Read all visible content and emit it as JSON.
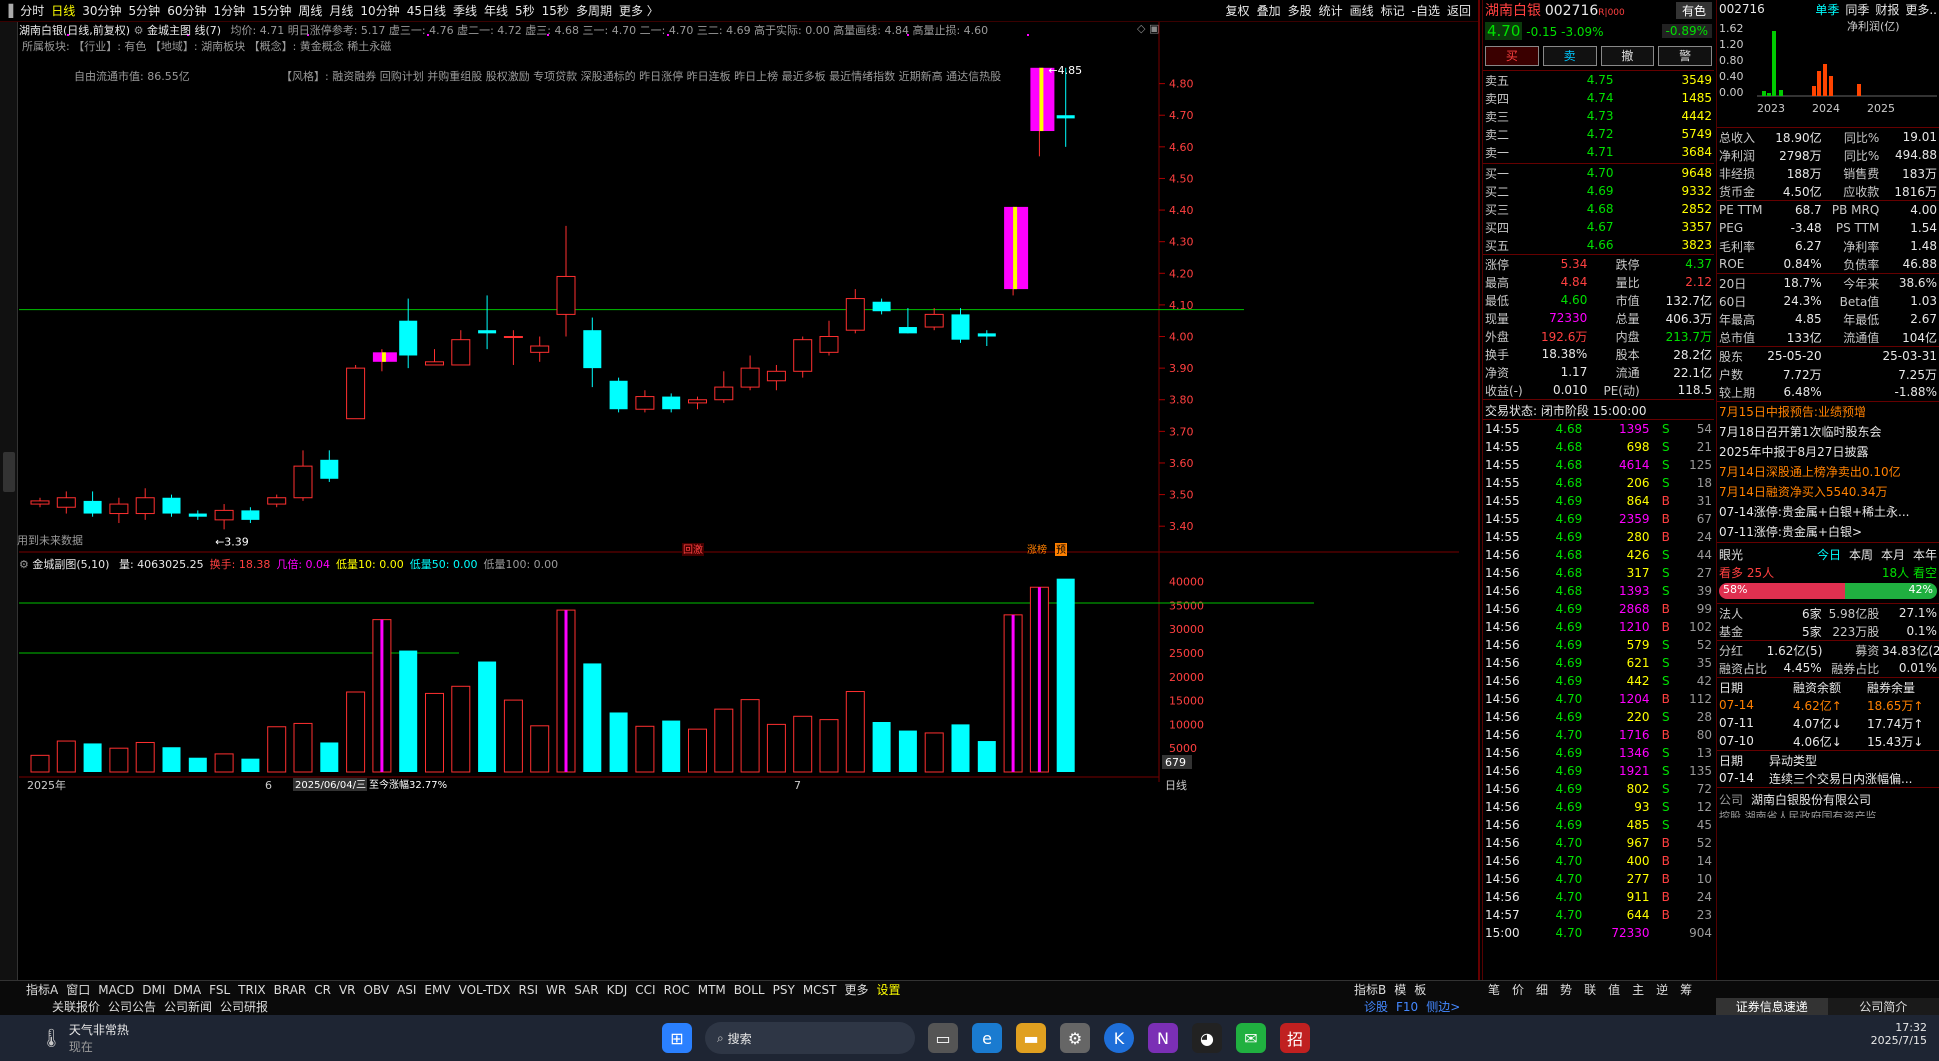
{
  "period_tabs": [
    "分时",
    "日线",
    "30分钟",
    "5分钟",
    "60分钟",
    "1分钟",
    "15分钟",
    "周线",
    "月线",
    "10分钟",
    "45日线",
    "季线",
    "年线",
    "5秒",
    "15秒",
    "多周期",
    "更多 〉"
  ],
  "top_right_menu": [
    "复权",
    "叠加",
    "多股",
    "统计",
    "画线",
    "标记",
    "-自选",
    "返回"
  ],
  "chart_title": "湖南白银(日线,前复权)",
  "indicator_main": "金城主图 线(7)",
  "stats_line": "均价: 4.71 明日涨停参考: 5.17 虚三一: 4.76 虚二一: 4.72 虚三: 4.68 三一: 4.70 二一: 4.70 三二: 4.69 高于实际: 0.00 高量画线: 4.84 高量止损: 4.60",
  "info_line": "所属板块:   【行业】: 有色   【地域】: 湖南板块   【概念】: 黄金概念 稀土永磁",
  "float_cap": "自由流通市值: 86.55亿",
  "style_line": "【风格】: 融资融券 回购计划 并购重组股 股权激励 专项贷款 深股通标的 昨日涨停 昨日连板 昨日上榜 最近多板 最近情绪指数 近期新高 通达信热股",
  "future_label": "用到未来数据",
  "low_label": "←3.39",
  "high_label": "←4.85",
  "tag_huiji": "回激",
  "tag_zhangbang": "涨榜",
  "tag_yu": "预",
  "price_ticks": [
    "4.80",
    "4.70",
    "4.60",
    "4.50",
    "4.40",
    "4.30",
    "4.20",
    "4.10",
    "4.00",
    "3.90",
    "3.80",
    "3.70",
    "3.60",
    "3.50",
    "3.40"
  ],
  "sub_title": "金城副图(5,10)",
  "sub_line": [
    {
      "t": "量: 4063025.25",
      "cls": "w"
    },
    {
      "t": "换手: 18.38",
      "cls": "r"
    },
    {
      "t": "几倍: 0.04",
      "cls": "m"
    },
    {
      "t": "低量10: 0.00",
      "cls": "y"
    },
    {
      "t": "低量50: 0.00",
      "cls": "c"
    },
    {
      "t": "低量100: 0.00",
      "cls": "gr"
    }
  ],
  "vol_ticks": [
    "40000",
    "35000",
    "30000",
    "25000",
    "20000",
    "15000",
    "10000",
    "5000"
  ],
  "vol_cursor": "679",
  "x_labels": {
    "year": "2025年",
    "m6": "6",
    "m7": "7",
    "date_box": "2025/06/04/三",
    "pct": "至今涨幅32.77%"
  },
  "ri_xian": "日线",
  "chart_data": {
    "type": "candlestick",
    "xlabel": "",
    "ylabel": "",
    "ylim": [
      3.35,
      4.9
    ],
    "candles": [
      {
        "o": 3.47,
        "c": 3.48,
        "h": 3.49,
        "l": 3.46,
        "v": 3500
      },
      {
        "o": 3.46,
        "c": 3.49,
        "h": 3.51,
        "l": 3.44,
        "v": 6500
      },
      {
        "o": 3.48,
        "c": 3.44,
        "h": 3.51,
        "l": 3.43,
        "v": 6000
      },
      {
        "o": 3.44,
        "c": 3.47,
        "h": 3.49,
        "l": 3.41,
        "v": 5000
      },
      {
        "o": 3.44,
        "c": 3.49,
        "h": 3.52,
        "l": 3.42,
        "v": 6200
      },
      {
        "o": 3.49,
        "c": 3.44,
        "h": 3.5,
        "l": 3.43,
        "v": 5200
      },
      {
        "o": 3.44,
        "c": 3.43,
        "h": 3.45,
        "l": 3.42,
        "v": 3000
      },
      {
        "o": 3.42,
        "c": 3.45,
        "h": 3.47,
        "l": 3.39,
        "v": 3800
      },
      {
        "o": 3.45,
        "c": 3.42,
        "h": 3.46,
        "l": 3.41,
        "v": 2800
      },
      {
        "o": 3.47,
        "c": 3.49,
        "h": 3.5,
        "l": 3.46,
        "v": 9500
      },
      {
        "o": 3.49,
        "c": 3.59,
        "h": 3.64,
        "l": 3.48,
        "v": 10200
      },
      {
        "o": 3.61,
        "c": 3.55,
        "h": 3.64,
        "l": 3.54,
        "v": 6200
      },
      {
        "o": 3.74,
        "c": 3.9,
        "h": 3.91,
        "l": 3.74,
        "v": 16800
      },
      {
        "o": 3.92,
        "c": 3.95,
        "h": 3.96,
        "l": 3.89,
        "v": 32000
      },
      {
        "o": 4.05,
        "c": 3.94,
        "h": 4.12,
        "l": 3.9,
        "v": 25500
      },
      {
        "o": 3.91,
        "c": 3.92,
        "h": 3.96,
        "l": 3.91,
        "v": 16500
      },
      {
        "o": 3.91,
        "c": 3.99,
        "h": 4.02,
        "l": 3.91,
        "v": 18000
      },
      {
        "o": 4.02,
        "c": 4.01,
        "h": 4.13,
        "l": 3.96,
        "v": 23200
      },
      {
        "o": 4.0,
        "c": 4.0,
        "h": 4.02,
        "l": 3.91,
        "v": 15100
      },
      {
        "o": 3.95,
        "c": 3.97,
        "h": 4.0,
        "l": 3.92,
        "v": 9700
      },
      {
        "o": 4.07,
        "c": 4.19,
        "h": 4.35,
        "l": 4.0,
        "v": 34000
      },
      {
        "o": 4.02,
        "c": 3.9,
        "h": 4.06,
        "l": 3.84,
        "v": 22800
      },
      {
        "o": 3.86,
        "c": 3.77,
        "h": 3.87,
        "l": 3.76,
        "v": 12500
      },
      {
        "o": 3.77,
        "c": 3.81,
        "h": 3.83,
        "l": 3.76,
        "v": 9600
      },
      {
        "o": 3.81,
        "c": 3.77,
        "h": 3.82,
        "l": 3.76,
        "v": 10800
      },
      {
        "o": 3.79,
        "c": 3.8,
        "h": 3.81,
        "l": 3.77,
        "v": 9000
      },
      {
        "o": 3.8,
        "c": 3.84,
        "h": 3.89,
        "l": 3.79,
        "v": 13200
      },
      {
        "o": 3.84,
        "c": 3.9,
        "h": 3.94,
        "l": 3.83,
        "v": 15200
      },
      {
        "o": 3.86,
        "c": 3.89,
        "h": 3.91,
        "l": 3.83,
        "v": 10000
      },
      {
        "o": 3.89,
        "c": 3.99,
        "h": 4.0,
        "l": 3.87,
        "v": 11700
      },
      {
        "o": 3.95,
        "c": 4.0,
        "h": 4.05,
        "l": 3.94,
        "v": 11000
      },
      {
        "o": 4.02,
        "c": 4.12,
        "h": 4.15,
        "l": 4.01,
        "v": 16900
      },
      {
        "o": 4.11,
        "c": 4.08,
        "h": 4.12,
        "l": 4.07,
        "v": 10500
      },
      {
        "o": 4.03,
        "c": 4.01,
        "h": 4.09,
        "l": 4.01,
        "v": 8700
      },
      {
        "o": 4.03,
        "c": 4.07,
        "h": 4.09,
        "l": 4.02,
        "v": 8200
      },
      {
        "o": 4.07,
        "c": 3.99,
        "h": 4.09,
        "l": 3.98,
        "v": 10000
      },
      {
        "o": 4.01,
        "c": 4.0,
        "h": 4.02,
        "l": 3.97,
        "v": 6500
      },
      {
        "o": 4.15,
        "c": 4.41,
        "h": 4.41,
        "l": 4.13,
        "v": 33000
      },
      {
        "o": 4.65,
        "c": 4.85,
        "h": 4.85,
        "l": 4.57,
        "v": 38800
      },
      {
        "o": 4.7,
        "c": 4.69,
        "h": 4.85,
        "l": 4.6,
        "v": 40600
      }
    ]
  },
  "stock": {
    "name": "湖南白银",
    "code": "002716",
    "tag": "R|000",
    "sector": "有色",
    "price": "4.70",
    "chg": "-0.15",
    "pct": "-3.09%",
    "pct2": "-0.89%"
  },
  "buttons": [
    "买",
    "卖",
    "撤",
    "警"
  ],
  "asks": [
    [
      "卖五",
      "4.75",
      "3549"
    ],
    [
      "卖四",
      "4.74",
      "1485"
    ],
    [
      "卖三",
      "4.73",
      "4442"
    ],
    [
      "卖二",
      "4.72",
      "5749"
    ],
    [
      "卖一",
      "4.71",
      "3684"
    ]
  ],
  "bids": [
    [
      "买一",
      "4.70",
      "9648"
    ],
    [
      "买二",
      "4.69",
      "9332"
    ],
    [
      "买三",
      "4.68",
      "2852"
    ],
    [
      "买四",
      "4.67",
      "3357"
    ],
    [
      "买五",
      "4.66",
      "3823"
    ]
  ],
  "quote": [
    [
      "涨停",
      "5.34",
      "跌停",
      "4.37"
    ],
    [
      "最高",
      "4.84",
      "量比",
      "2.12"
    ],
    [
      "最低",
      "4.60",
      "市值",
      "132.7亿"
    ],
    [
      "现量",
      "72330",
      "总量",
      "406.3万"
    ],
    [
      "外盘",
      "192.6万",
      "内盘",
      "213.7万"
    ],
    [
      "换手",
      "18.38%",
      "股本",
      "28.2亿"
    ],
    [
      "净资",
      "1.17",
      "流通",
      "22.1亿"
    ],
    [
      "收益(-)",
      "0.010",
      "PE(动)",
      "118.5"
    ]
  ],
  "trade_status": "交易状态: 闭市阶段 15:00:00",
  "ticks": [
    [
      "14:55",
      "4.68",
      "1395",
      "S",
      "54"
    ],
    [
      "14:55",
      "4.68",
      "698",
      "S",
      "21"
    ],
    [
      "14:55",
      "4.68",
      "4614",
      "S",
      "125"
    ],
    [
      "14:55",
      "4.68",
      "206",
      "S",
      "18"
    ],
    [
      "14:55",
      "4.69",
      "864",
      "B",
      "31"
    ],
    [
      "14:55",
      "4.69",
      "2359",
      "B",
      "67"
    ],
    [
      "14:55",
      "4.69",
      "280",
      "B",
      "24"
    ],
    [
      "14:56",
      "4.68",
      "426",
      "S",
      "44"
    ],
    [
      "14:56",
      "4.68",
      "317",
      "S",
      "27"
    ],
    [
      "14:56",
      "4.68",
      "1393",
      "S",
      "39"
    ],
    [
      "14:56",
      "4.69",
      "2868",
      "B",
      "99"
    ],
    [
      "14:56",
      "4.69",
      "1210",
      "B",
      "102"
    ],
    [
      "14:56",
      "4.69",
      "579",
      "S",
      "52"
    ],
    [
      "14:56",
      "4.69",
      "621",
      "S",
      "35"
    ],
    [
      "14:56",
      "4.69",
      "442",
      "S",
      "42"
    ],
    [
      "14:56",
      "4.70",
      "1204",
      "B",
      "112"
    ],
    [
      "14:56",
      "4.69",
      "220",
      "S",
      "28"
    ],
    [
      "14:56",
      "4.70",
      "1716",
      "B",
      "80"
    ],
    [
      "14:56",
      "4.69",
      "1346",
      "S",
      "13"
    ],
    [
      "14:56",
      "4.69",
      "1921",
      "S",
      "135"
    ],
    [
      "14:56",
      "4.69",
      "802",
      "S",
      "72"
    ],
    [
      "14:56",
      "4.69",
      "93",
      "S",
      "12"
    ],
    [
      "14:56",
      "4.69",
      "485",
      "S",
      "45"
    ],
    [
      "14:56",
      "4.70",
      "967",
      "B",
      "52"
    ],
    [
      "14:56",
      "4.70",
      "400",
      "B",
      "14"
    ],
    [
      "14:56",
      "4.70",
      "277",
      "B",
      "10"
    ],
    [
      "14:56",
      "4.70",
      "911",
      "B",
      "24"
    ],
    [
      "14:57",
      "4.70",
      "644",
      "B",
      "23"
    ],
    [
      "15:00",
      "4.70",
      "72330",
      "",
      "904"
    ]
  ],
  "rp2": {
    "code": "002716",
    "tabs": [
      "单季",
      "同季",
      "财报",
      "更多.."
    ],
    "chart_label": "净利润(亿)",
    "yticks": [
      "1.62",
      "1.20",
      "0.80",
      "0.40",
      "0.00"
    ],
    "years": [
      "2023",
      "2024",
      "2025"
    ],
    "fin": [
      [
        "总收入",
        "18.90亿",
        "同比%",
        "19.01"
      ],
      [
        "净利润",
        "2798万",
        "同比%",
        "494.88"
      ],
      [
        "非经损",
        "188万",
        "销售费",
        "183万"
      ],
      [
        "货币金",
        "4.50亿",
        "应收款",
        "1816万"
      ]
    ],
    "val": [
      [
        "PE TTM",
        "68.7",
        "PB MRQ",
        "4.00"
      ],
      [
        "PEG",
        "-3.48",
        "PS TTM",
        "1.54"
      ],
      [
        "毛利率",
        "6.27",
        "净利率",
        "1.48"
      ],
      [
        "ROE",
        "0.84%",
        "负债率",
        "46.88"
      ]
    ],
    "perf": [
      [
        "20日",
        "18.7%",
        "今年来",
        "38.6%"
      ],
      [
        "60日",
        "24.3%",
        "Beta值",
        "1.03"
      ],
      [
        "年最高",
        "4.85",
        "年最低",
        "2.67"
      ],
      [
        "总市值",
        "133亿",
        "流通值",
        "104亿"
      ]
    ],
    "holders": [
      [
        "股东",
        "25-05-20",
        "",
        "25-03-31"
      ],
      [
        "户数",
        "7.72万",
        "",
        "7.25万"
      ],
      [
        "较上期",
        "6.48%",
        "",
        "-1.88%"
      ]
    ],
    "news": [
      {
        "t": "7月15日中报预告:业绩预增",
        "c": "o"
      },
      {
        "t": "7月18日召开第1次临时股东会",
        "c": "w"
      },
      {
        "t": "2025年中报于8月27日披露",
        "c": "w"
      },
      {
        "t": "7月14日深股通上榜净卖出0.10亿",
        "c": "o"
      },
      {
        "t": "7月14日融资净买入5540.34万",
        "c": "o"
      },
      {
        "t": "07-14涨停:贵金属+白银+稀土永...",
        "c": "w"
      },
      {
        "t": "07-11涨停:贵金属+白银>",
        "c": "w"
      }
    ],
    "eye": {
      "label": "眼光",
      "tabs": [
        "今日",
        "本周",
        "本月",
        "本年"
      ],
      "bull": "看多 25人",
      "bear": "18人 看空",
      "bull_pct": "58%",
      "bear_pct": "42%"
    },
    "inst": [
      [
        "法人",
        "6家",
        "5.98亿股",
        "27.1%"
      ],
      [
        "基金",
        "5家",
        "223万股",
        "0.1%"
      ]
    ],
    "div": [
      [
        "分红",
        "1.62亿(5)",
        "募资",
        "34.83亿(2)"
      ],
      [
        "融资占比",
        "4.45%",
        "融券占比",
        "0.01%"
      ]
    ],
    "margin_head": [
      "日期",
      "融资余额",
      "融券余量"
    ],
    "margin": [
      [
        "07-14",
        "4.62亿↑",
        "18.65万↑"
      ],
      [
        "07-11",
        "4.07亿↓",
        "17.74万↑"
      ],
      [
        "07-10",
        "4.06亿↓",
        "15.43万↓"
      ]
    ],
    "abn_head": [
      "日期",
      "异动类型"
    ],
    "abn": [
      [
        "07-14",
        "连续三个交易日内涨幅偏..."
      ]
    ],
    "company": [
      "公司",
      "湖南白银股份有限公司"
    ],
    "controller": "控股 湖南省人民政府国有资产监..."
  },
  "bottom_tabs": [
    "指标A",
    "窗口",
    "MACD",
    "DMI",
    "DMA",
    "FSL",
    "TRIX",
    "BRAR",
    "CR",
    "VR",
    "OBV",
    "ASI",
    "EMV",
    "VOL-TDX",
    "RSI",
    "WR",
    "SAR",
    "KDJ",
    "CCI",
    "ROC",
    "MTM",
    "BOLL",
    "PSY",
    "MCST",
    "更多",
    "设置"
  ],
  "bottom_tabs2": [
    "关联报价",
    "公司公告",
    "公司新闻",
    "公司研报"
  ],
  "bottom_right": [
    "指标B",
    "模",
    "板"
  ],
  "bottom_right2": [
    "诊股",
    "F10",
    "侧边>"
  ],
  "side_tabs": [
    "笔",
    "价",
    "细",
    "势",
    "联",
    "值",
    "主",
    "逆",
    "筹"
  ],
  "side_tabs2": [
    "证券信息速递",
    "公司简介"
  ],
  "taskbar": {
    "weather": "天气非常热",
    "weather2": "现在",
    "search": "搜索",
    "time": "17:32",
    "date": "2025/7/15"
  }
}
